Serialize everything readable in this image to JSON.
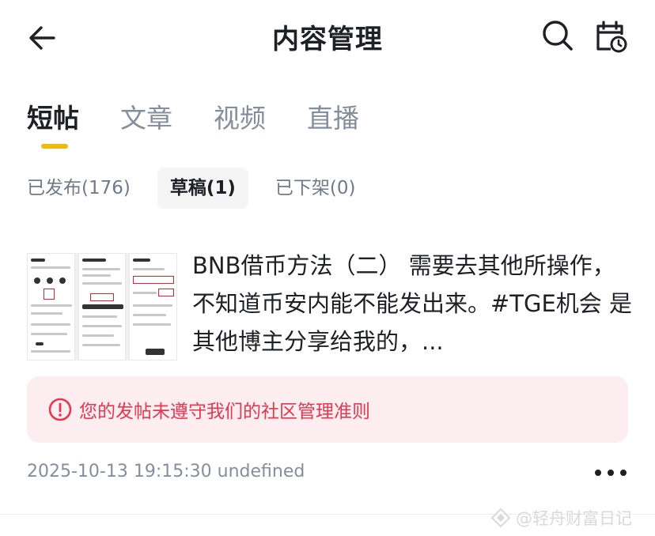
{
  "header": {
    "title": "内容管理",
    "back_icon": "arrow-left-icon",
    "search_icon": "search-icon",
    "calendar_icon": "calendar-clock-icon"
  },
  "tabs": [
    {
      "label": "短帖",
      "active": true
    },
    {
      "label": "文章",
      "active": false
    },
    {
      "label": "视频",
      "active": false
    },
    {
      "label": "直播",
      "active": false
    }
  ],
  "filters": [
    {
      "label": "已发布(176)",
      "active": false
    },
    {
      "label": "草稿(1)",
      "active": true
    },
    {
      "label": "已下架(0)",
      "active": false
    }
  ],
  "post": {
    "text": "BNB借币方法（二） 需要去其他所操作，不知道币安内能不能发出来。#TGE机会 是其他博主分享给我的，...",
    "warning": "您的发帖未遵守我们的社区管理准则",
    "timestamp": "2025-10-13 19:15:30 undefined"
  },
  "watermark": {
    "text": "@轻舟财富日记"
  },
  "colors": {
    "accent": "#f0b90b",
    "warning_text": "#e5384f",
    "warning_bg": "#fceef0"
  }
}
